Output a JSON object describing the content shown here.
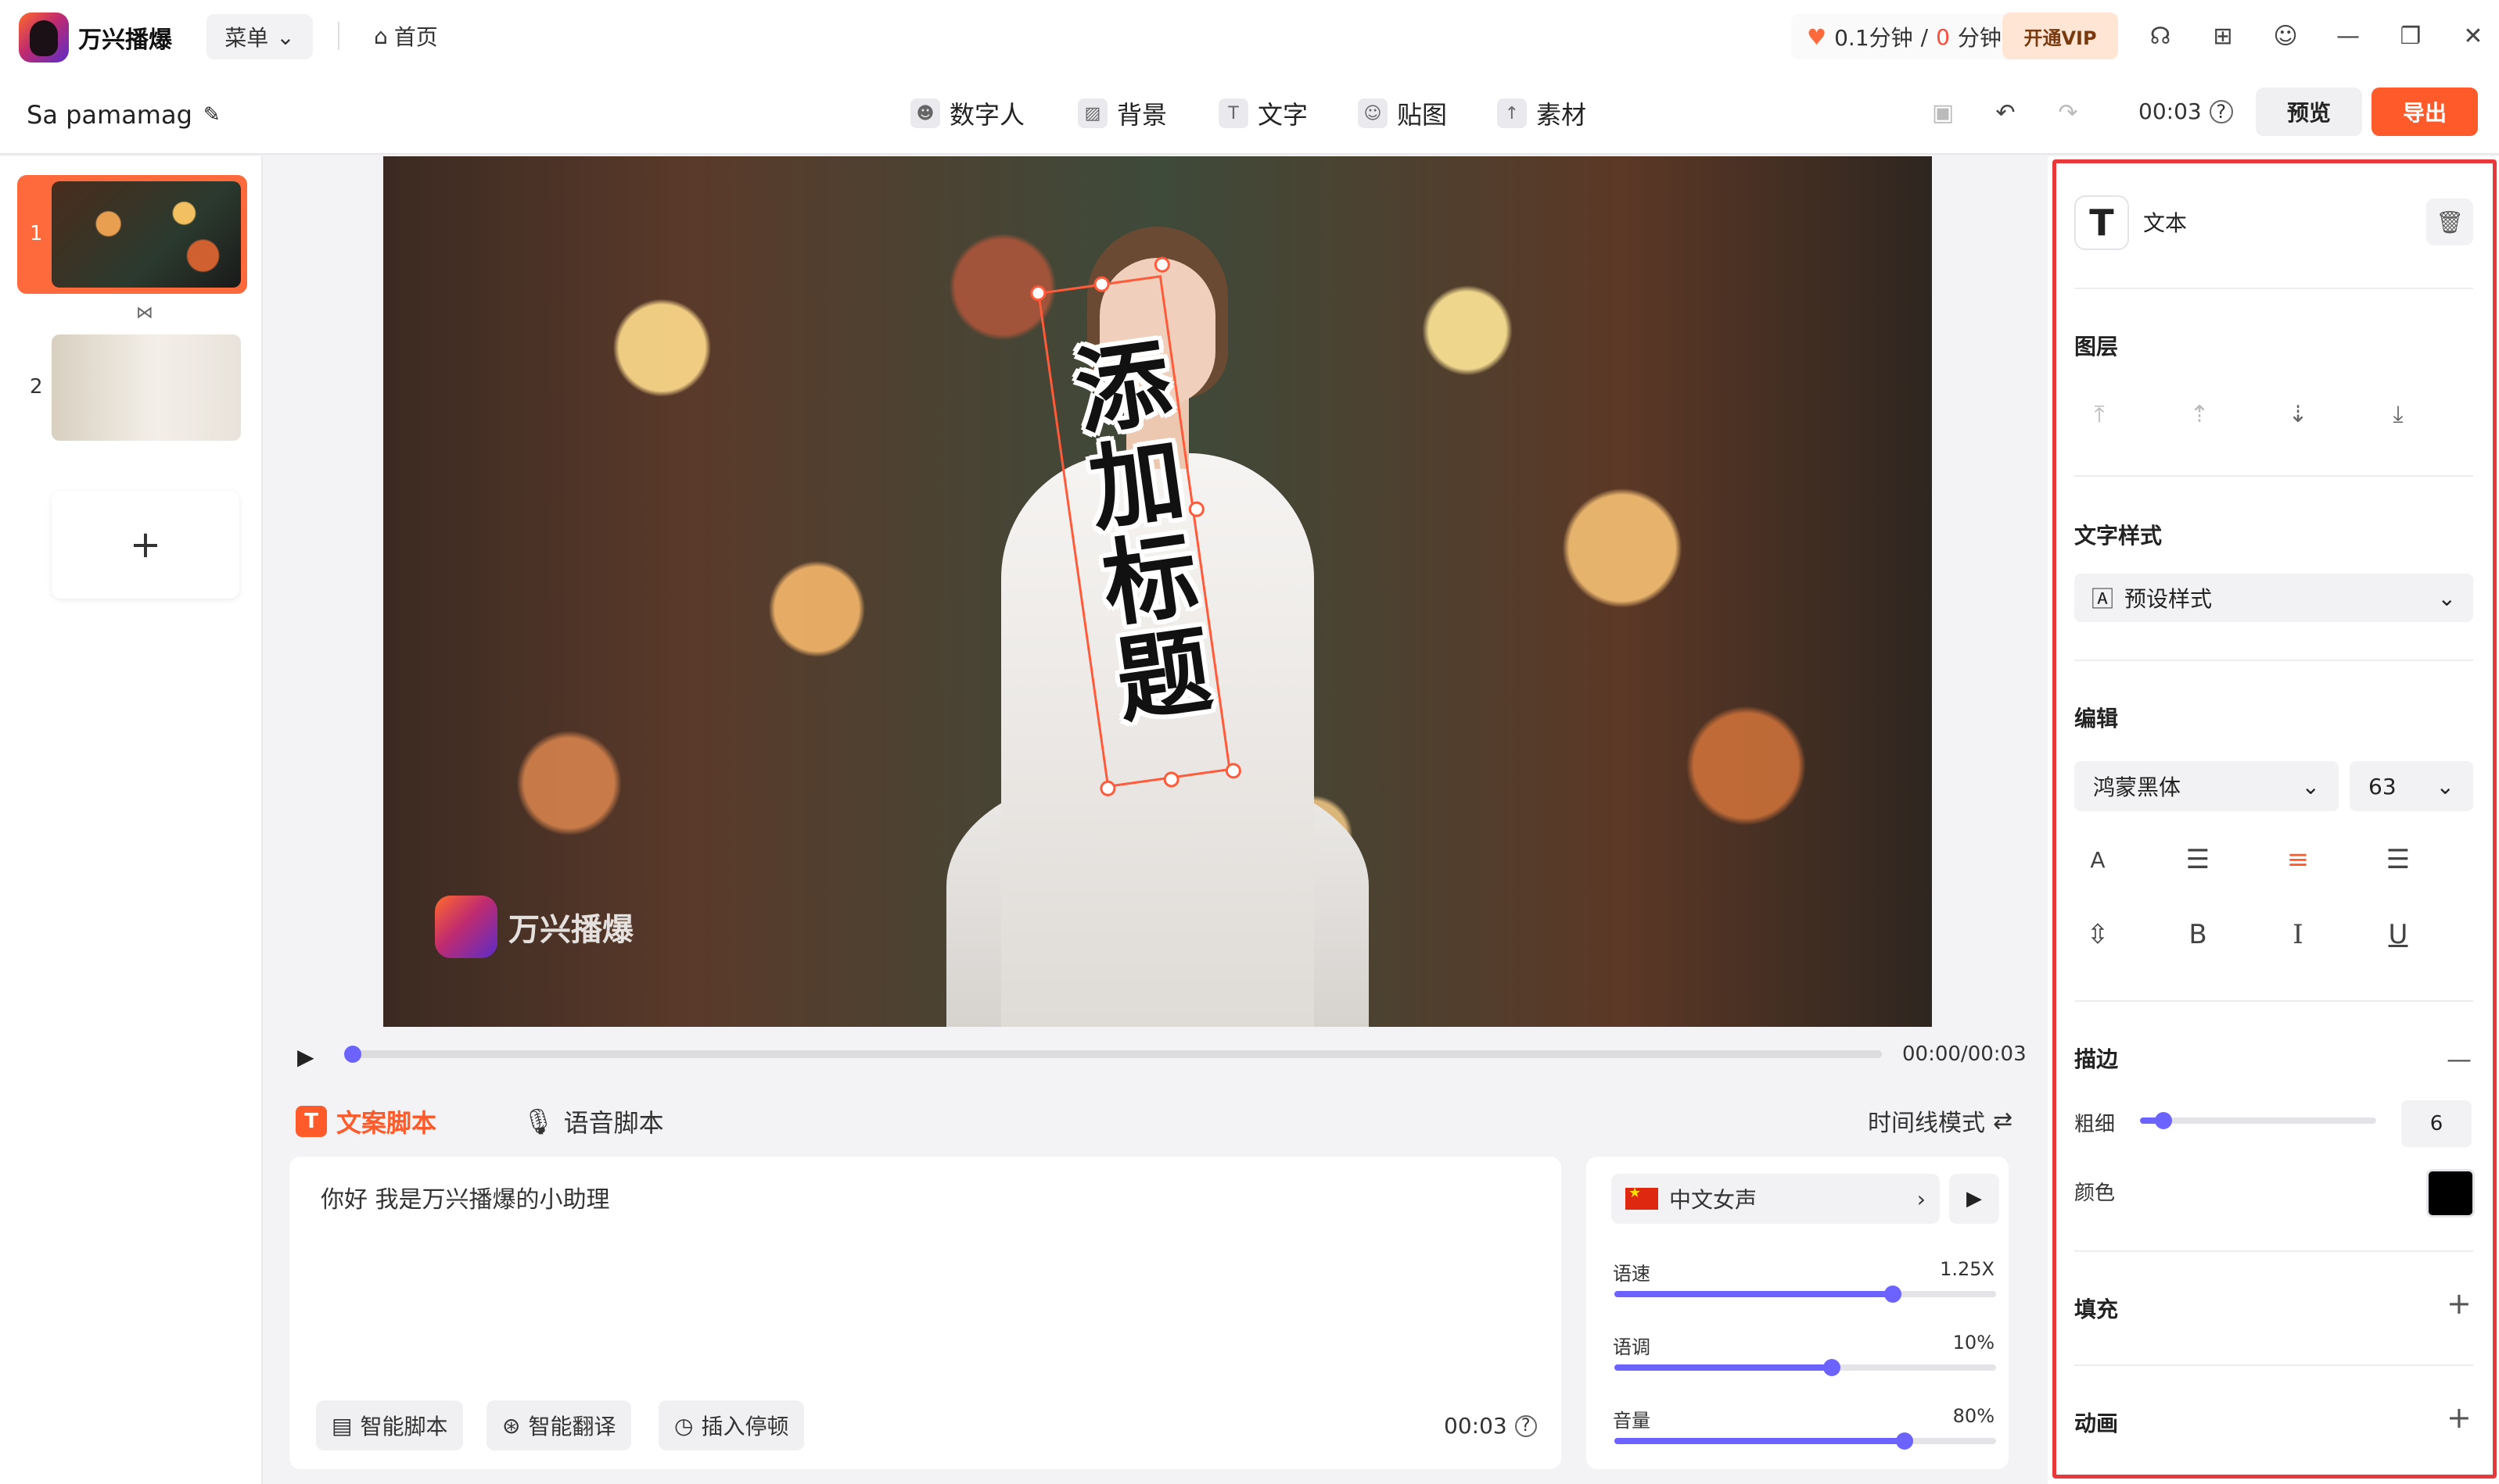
{
  "app": {
    "name": "万兴播爆",
    "menu_label": "菜单",
    "home_label": "首页"
  },
  "usage": {
    "used": "0.1分钟",
    "separator": "/",
    "remaining": "0",
    "remaining_unit": "分钟"
  },
  "vip_label": "开通VIP",
  "window_controls": [
    "headset-icon",
    "grid-icon",
    "user-icon",
    "minimize-icon",
    "restore-icon",
    "close-icon"
  ],
  "project": {
    "name": "Sa pamamag"
  },
  "tools": [
    {
      "label": "数字人",
      "icon": "avatar-icon"
    },
    {
      "label": "背景",
      "icon": "background-icon"
    },
    {
      "label": "文字",
      "icon": "text-icon"
    },
    {
      "label": "贴图",
      "icon": "sticker-icon"
    },
    {
      "label": "素材",
      "icon": "upload-icon"
    }
  ],
  "toolbar": {
    "duration": "00:03",
    "preview_label": "预览",
    "export_label": "导出"
  },
  "scenes": [
    {
      "number": "1",
      "selected": true
    },
    {
      "number": "2",
      "selected": false
    }
  ],
  "canvas": {
    "title_text": "添加标题",
    "watermark": "万兴播爆"
  },
  "playback": {
    "time": "00:00/00:03",
    "progress": 0
  },
  "script": {
    "tab_copy": "文案脚本",
    "tab_voice": "语音脚本",
    "timeline_mode": "时间线模式",
    "text": "你好  我是万兴播爆的小助理",
    "actions": [
      "智能脚本",
      "智能翻译",
      "插入停顿"
    ],
    "duration": "00:03"
  },
  "voice": {
    "name": "中文女声",
    "speed": {
      "label": "语速",
      "value": "1.25X",
      "level": 0.73
    },
    "pitch": {
      "label": "语调",
      "value": "10%",
      "level": 0.57
    },
    "volume": {
      "label": "音量",
      "value": "80%",
      "level": 0.76
    }
  },
  "properties": {
    "element_label": "文本",
    "layer_title": "图层",
    "text_style_title": "文字样式",
    "preset_style": "预设样式",
    "edit_title": "编辑",
    "font": "鸿蒙黑体",
    "font_size": "63",
    "stroke_title": "描边",
    "thickness_label": "粗细",
    "thickness_value": "6",
    "thickness_level": 0.1,
    "color_label": "颜色",
    "stroke_color": "#000000",
    "fill_title": "填充",
    "animation_title": "动画"
  },
  "colors": {
    "accent": "#ff5a2a",
    "slider": "#6c63ff",
    "highlight": "#e8383a"
  }
}
